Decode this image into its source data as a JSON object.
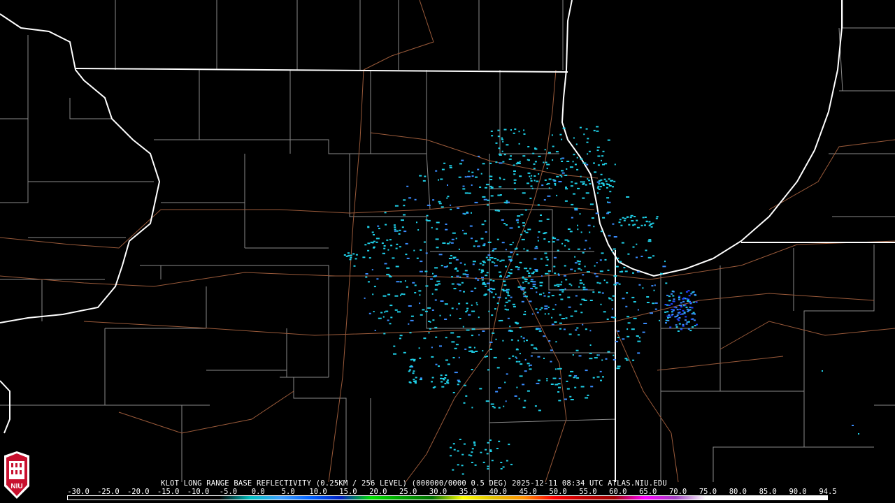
{
  "caption": {
    "text": "KLOT LONG RANGE BASE REFLECTIVITY (0.25KM / 256 LEVEL) (000000/0000 0.5 DEG) 2025-12-11 08:34 UTC  ATLAS.NIU.EDU"
  },
  "scale": {
    "labels": [
      "-30.0",
      "-25.0",
      "-20.0",
      "-15.0",
      "-10.0",
      "-5.0",
      "0.0",
      "5.0",
      "10.0",
      "15.0",
      "20.0",
      "25.0",
      "30.0",
      "35.0",
      "40.0",
      "45.0",
      "50.0",
      "55.0",
      "60.0",
      "65.0",
      "70.0",
      "75.0",
      "80.0",
      "85.0",
      "90.0",
      "94.5"
    ],
    "colors": [
      "#000000",
      "#000000",
      "#000000",
      "#000000",
      "#000000",
      "#000000",
      "#00c0c0",
      "#3fa0ff",
      "#0060ff",
      "#0020c0",
      "#00e000",
      "#00a000",
      "#007000",
      "#ffff00",
      "#e0c000",
      "#ff9000",
      "#ff0000",
      "#c00000",
      "#a00000",
      "#ff00ff",
      "#a040c0",
      "#ffffff",
      "#ffffff",
      "#ffffff",
      "#ffffff",
      "#ffffff"
    ]
  },
  "logo": {
    "text": "NIU"
  },
  "colors": {
    "background": "#000000",
    "state_border": "#ffffff",
    "county_line": "#8a8a8a",
    "highway": "#9a5a3a",
    "echo_light": "#1fd0e8",
    "echo_mid": "#3a8cff",
    "echo_strong": "#2040ff"
  }
}
